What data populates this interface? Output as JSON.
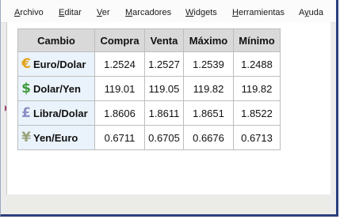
{
  "menu": {
    "items": [
      {
        "label": "Archivo",
        "accel": 0
      },
      {
        "label": "Editar",
        "accel": 0
      },
      {
        "label": "Ver",
        "accel": 0
      },
      {
        "label": "Marcadores",
        "accel": 0
      },
      {
        "label": "Widgets",
        "accel": 0
      },
      {
        "label": "Herramientas",
        "accel": 0
      },
      {
        "label": "Ayuda",
        "accel": 1
      }
    ]
  },
  "table": {
    "headers": [
      "Cambio",
      "Compra",
      "Venta",
      "Máximo",
      "Mínimo"
    ],
    "rows": [
      {
        "icon": "euro-icon",
        "icon_glyph": "€",
        "icon_color": "#e2a21b",
        "pair": "Euro/Dolar",
        "values": [
          "1.2524",
          "1.2527",
          "1.2539",
          "1.2488"
        ]
      },
      {
        "icon": "dollar-icon",
        "icon_glyph": "$",
        "icon_color": "#3d9b3d",
        "pair": "Dolar/Yen",
        "values": [
          "119.01",
          "119.05",
          "119.82",
          "119.82"
        ]
      },
      {
        "icon": "pound-icon",
        "icon_glyph": "£",
        "icon_color": "#8a8fc4",
        "pair": "Libra/Dolar",
        "values": [
          "1.8606",
          "1.8611",
          "1.8651",
          "1.8522"
        ]
      },
      {
        "icon": "yen-icon",
        "icon_glyph": "¥",
        "icon_color": "#9aa37a",
        "pair": "Yen/Euro",
        "values": [
          "0.6711",
          "0.6705",
          "0.6676",
          "0.6713"
        ]
      }
    ]
  },
  "colors": {
    "window_border": "#2c3f7d",
    "header_bg": "#d9d9d9",
    "pair_bg": "#eaf3fb"
  }
}
